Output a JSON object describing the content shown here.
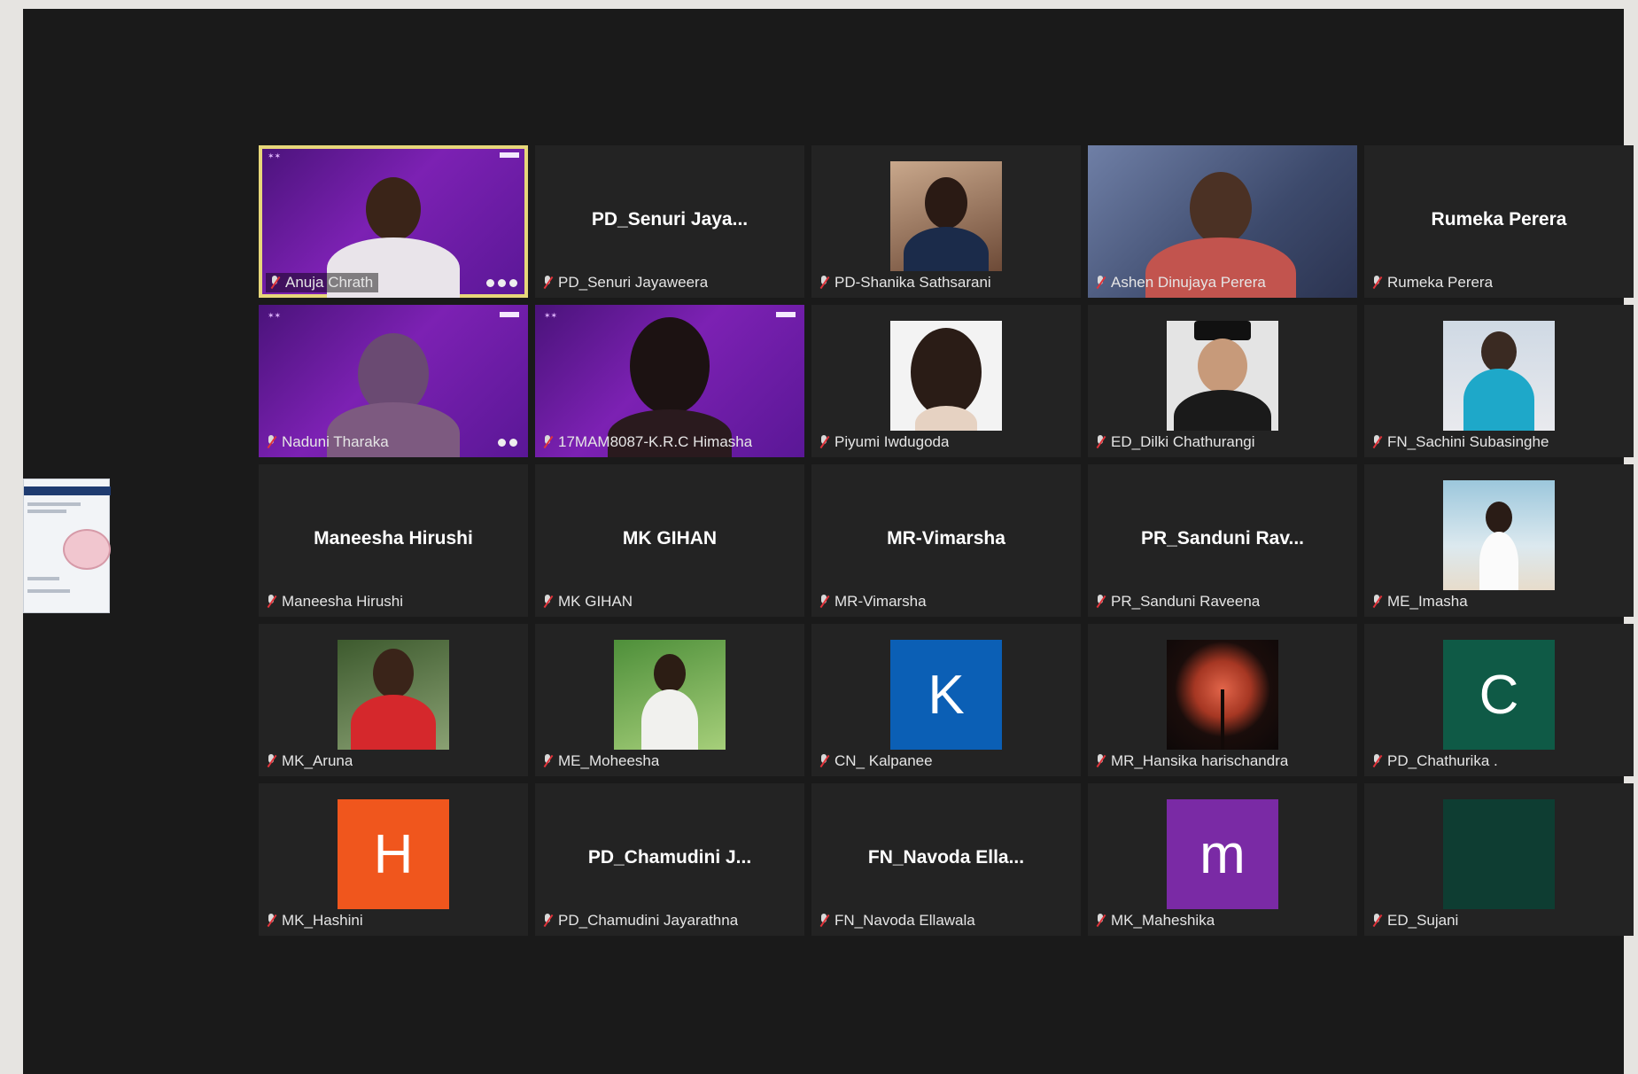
{
  "icons": {
    "mic_muted": "mic-muted-icon"
  },
  "colors": {
    "frame_bg": "#1a1a1a",
    "tile_bg": "#232323",
    "active_speaker_border": "#e7d77a",
    "muted_red": "#e0333a"
  },
  "participants": [
    {
      "caption": "Anuja Chrath",
      "big_name": "",
      "active": true,
      "view": "video-purple"
    },
    {
      "caption": "PD_Senuri Jayaweera",
      "big_name": "PD_Senuri  Jaya...",
      "view": "name"
    },
    {
      "caption": "PD-Shanika Sathsarani",
      "big_name": "",
      "view": "photo"
    },
    {
      "caption": "Ashen Dinujaya Perera",
      "big_name": "",
      "view": "video-blue"
    },
    {
      "caption": "Rumeka Perera",
      "big_name": "Rumeka Perera",
      "view": "name"
    },
    {
      "caption": "Naduni Tharaka",
      "big_name": "",
      "view": "video-purple"
    },
    {
      "caption": "17MAM8087-K.R.C Himasha",
      "big_name": "",
      "view": "video-purple"
    },
    {
      "caption": "Piyumi Iwdugoda",
      "big_name": "",
      "view": "photo"
    },
    {
      "caption": "ED_Dilki Chathurangi",
      "big_name": "",
      "view": "photo"
    },
    {
      "caption": "FN_Sachini Subasinghe",
      "big_name": "",
      "view": "photo"
    },
    {
      "caption": "Maneesha Hirushi",
      "big_name": "Maneesha Hirushi",
      "view": "name"
    },
    {
      "caption": "MK GIHAN",
      "big_name": "MK GIHAN",
      "view": "name"
    },
    {
      "caption": "MR-Vimarsha",
      "big_name": "MR-Vimarsha",
      "view": "name"
    },
    {
      "caption": "PR_Sanduni Raveena",
      "big_name": "PR_Sanduni  Rav...",
      "view": "name"
    },
    {
      "caption": "ME_Imasha",
      "big_name": "",
      "view": "photo"
    },
    {
      "caption": "MK_Aruna",
      "big_name": "",
      "view": "photo"
    },
    {
      "caption": "ME_Moheesha",
      "big_name": "",
      "view": "photo"
    },
    {
      "caption": "CN_ Kalpanee",
      "big_name": "",
      "view": "letter",
      "letter": "K",
      "letter_color": "#0b5fb5"
    },
    {
      "caption": "MR_Hansika harischandra",
      "big_name": "",
      "view": "photo"
    },
    {
      "caption": "PD_Chathurika .",
      "big_name": "",
      "view": "letter",
      "letter": "C",
      "letter_color": "#0f5a46"
    },
    {
      "caption": "MK_Hashini",
      "big_name": "",
      "view": "letter",
      "letter": "H",
      "letter_color": "#f0561d"
    },
    {
      "caption": "PD_Chamudini Jayarathna",
      "big_name": "PD_Chamudini  J...",
      "view": "name"
    },
    {
      "caption": "FN_Navoda Ellawala",
      "big_name": "FN_Navoda  Ella...",
      "view": "name"
    },
    {
      "caption": "MK_Maheshika",
      "big_name": "",
      "view": "letter",
      "letter": "m",
      "letter_color": "#7a2aa5"
    },
    {
      "caption": "ED_Sujani",
      "big_name": "",
      "view": "letter",
      "letter": "",
      "letter_color": "#0e3d32"
    }
  ]
}
